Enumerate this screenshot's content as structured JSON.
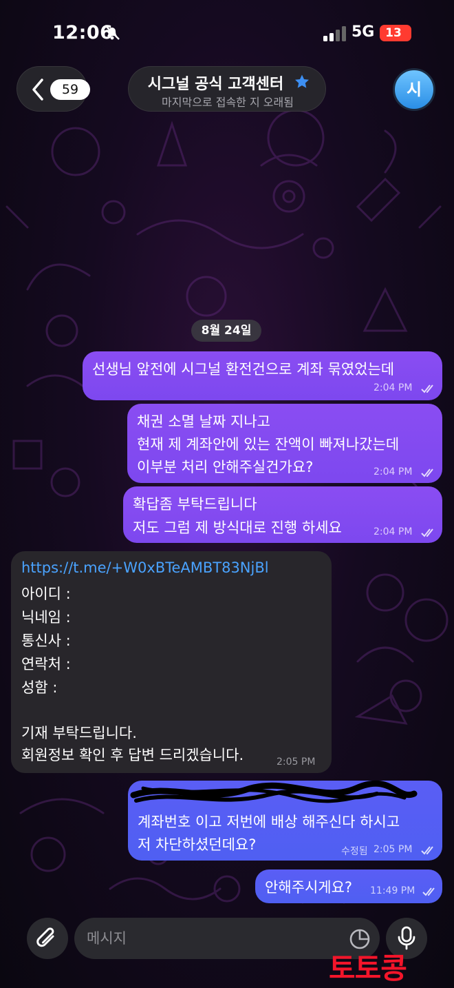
{
  "status_bar": {
    "time": "12:06",
    "network": "5G",
    "battery": "13"
  },
  "header": {
    "back_count": "59",
    "title": "시그널 공식 고객센터",
    "subtitle": "마지막으로 접속한 지 오래됨",
    "avatar_initial": "시",
    "verified_icon": "star-badge-icon"
  },
  "date_chip": "8월 24일",
  "messages": [
    {
      "direction": "out",
      "lines": [
        "선생님 앞전에 시그널 환전건으로 계좌 묶였었는데"
      ],
      "time": "2:04 PM",
      "status": "read"
    },
    {
      "direction": "out",
      "lines": [
        "채권 소멸 날짜 지나고",
        "현재 제 계좌안에 있는 잔액이 빠져나갔는데",
        "이부분 처리 안해주실건가요?"
      ],
      "time": "2:04 PM",
      "status": "read"
    },
    {
      "direction": "out",
      "lines": [
        "확답좀 부탁드립니다",
        "저도 그럼 제 방식대로 진행 하세요"
      ],
      "time": "2:04 PM",
      "status": "read"
    },
    {
      "direction": "in",
      "link": "https://t.me/+W0xBTeAMBT83NjBl",
      "lines": [
        "아이디 :",
        "닉네임 :",
        "통신사 :",
        "연락처 :",
        "성함 :",
        "",
        "기재 부탁드립니다.",
        "회원정보 확인 후 답변 드리겠습니다."
      ],
      "time": "2:05 PM"
    },
    {
      "direction": "out",
      "lines": [
        "계좌번호 이고 저번에 배상 해주신다 하시고",
        "저 차단하셨던데요?"
      ],
      "edited_label": "수정됨",
      "time": "2:05 PM",
      "status": "read"
    },
    {
      "direction": "out",
      "lines": [
        "안해주시게요?"
      ],
      "time": "11:49 PM",
      "status": "read"
    }
  ],
  "composer": {
    "placeholder": "메시지"
  },
  "watermark": "토토콩",
  "colors": {
    "outgoing_bubble": "#8a4df2",
    "outgoing_bubble_blue": "#5a5ef5",
    "incoming_bubble": "#28262b",
    "link": "#4aa3ff",
    "watermark": "#f3152a",
    "battery": "#ff3b30"
  }
}
